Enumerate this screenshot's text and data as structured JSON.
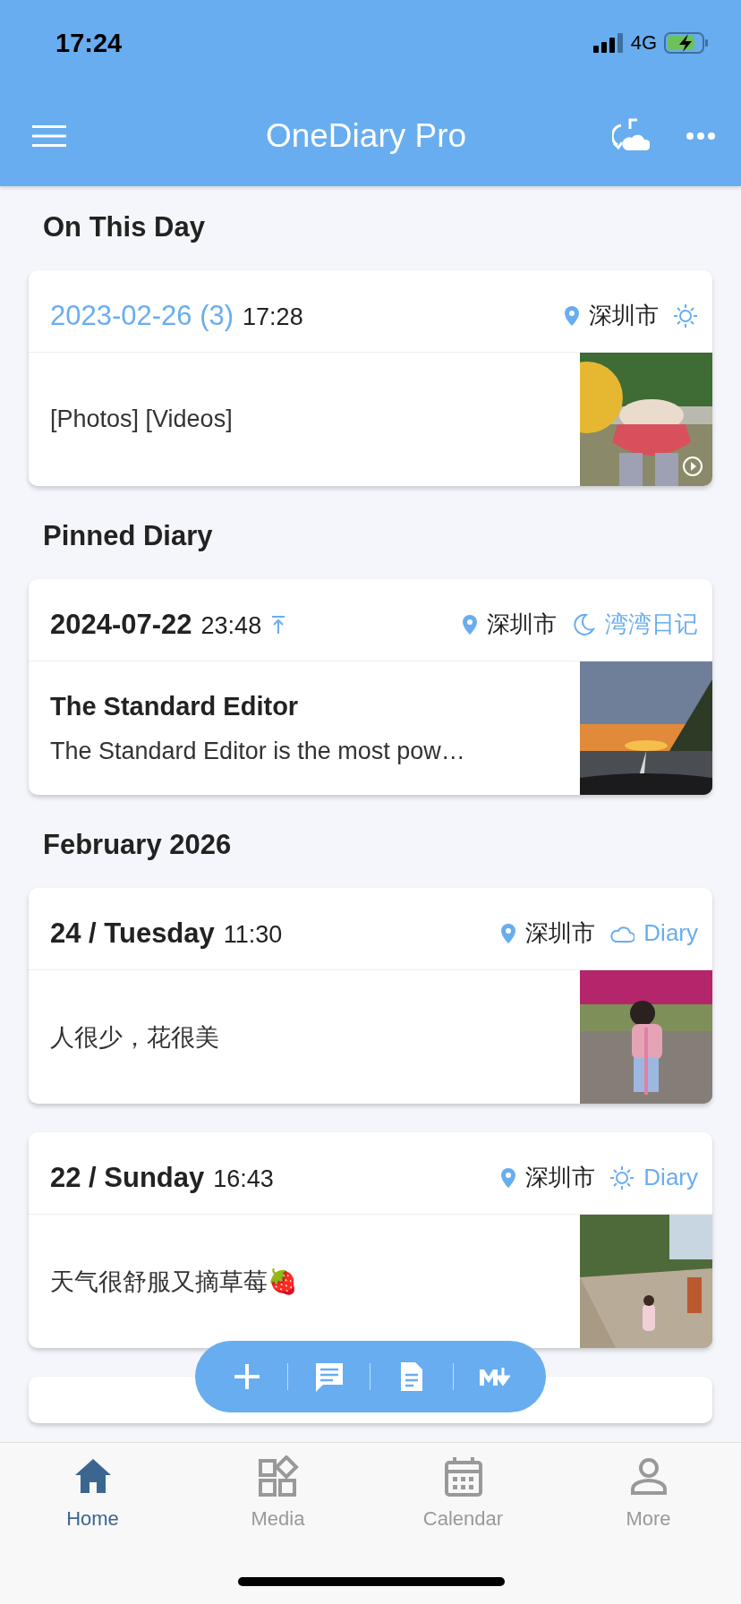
{
  "status_bar": {
    "time": "17:24",
    "network": "4G"
  },
  "header": {
    "title": "OneDiary Pro"
  },
  "sections": [
    {
      "title": "On This Day",
      "entries": [
        {
          "kind": "memory",
          "date": "2023-02-26 (3)",
          "time": "17:28",
          "pinned": false,
          "city": "深圳市",
          "weather": {
            "kind": "sun"
          },
          "text": "[Photos] [Videos]",
          "photo": {
            "kind": "picture",
            "video": true
          }
        }
      ]
    },
    {
      "title": "Pinned Diary",
      "entries": [
        {
          "kind": "entry",
          "date": "2024-07-22",
          "time": "23:48",
          "pinned": true,
          "city": "深圳市",
          "weather": {
            "kind": "moon"
          },
          "diary": "湾湾日记",
          "title": "The Standard Editor",
          "text": "The Standard Editor is the most pow…",
          "photo": {
            "kind": "picture",
            "video": false
          }
        }
      ]
    },
    {
      "title": "February 2026",
      "entries": [
        {
          "kind": "entry",
          "date": "24 / Tuesday",
          "time": "11:30",
          "pinned": false,
          "city": "深圳市",
          "weather": {
            "kind": "cloud"
          },
          "diary": "Diary",
          "text": "人很少，花很美",
          "photo": {
            "kind": "picture",
            "video": false
          }
        },
        {
          "kind": "entry",
          "date": "22 / Sunday",
          "time": "16:43",
          "pinned": false,
          "city": "深圳市",
          "weather": {
            "kind": "sun"
          },
          "diary": "Diary",
          "text": "天气很舒服又摘草莓🍓",
          "photo": {
            "kind": "picture",
            "video": false
          }
        }
      ]
    }
  ],
  "tabs": [
    {
      "label": "Home",
      "selected": true
    },
    {
      "label": "Media",
      "selected": false
    },
    {
      "label": "Calendar",
      "selected": false
    },
    {
      "label": "More",
      "selected": false
    }
  ]
}
